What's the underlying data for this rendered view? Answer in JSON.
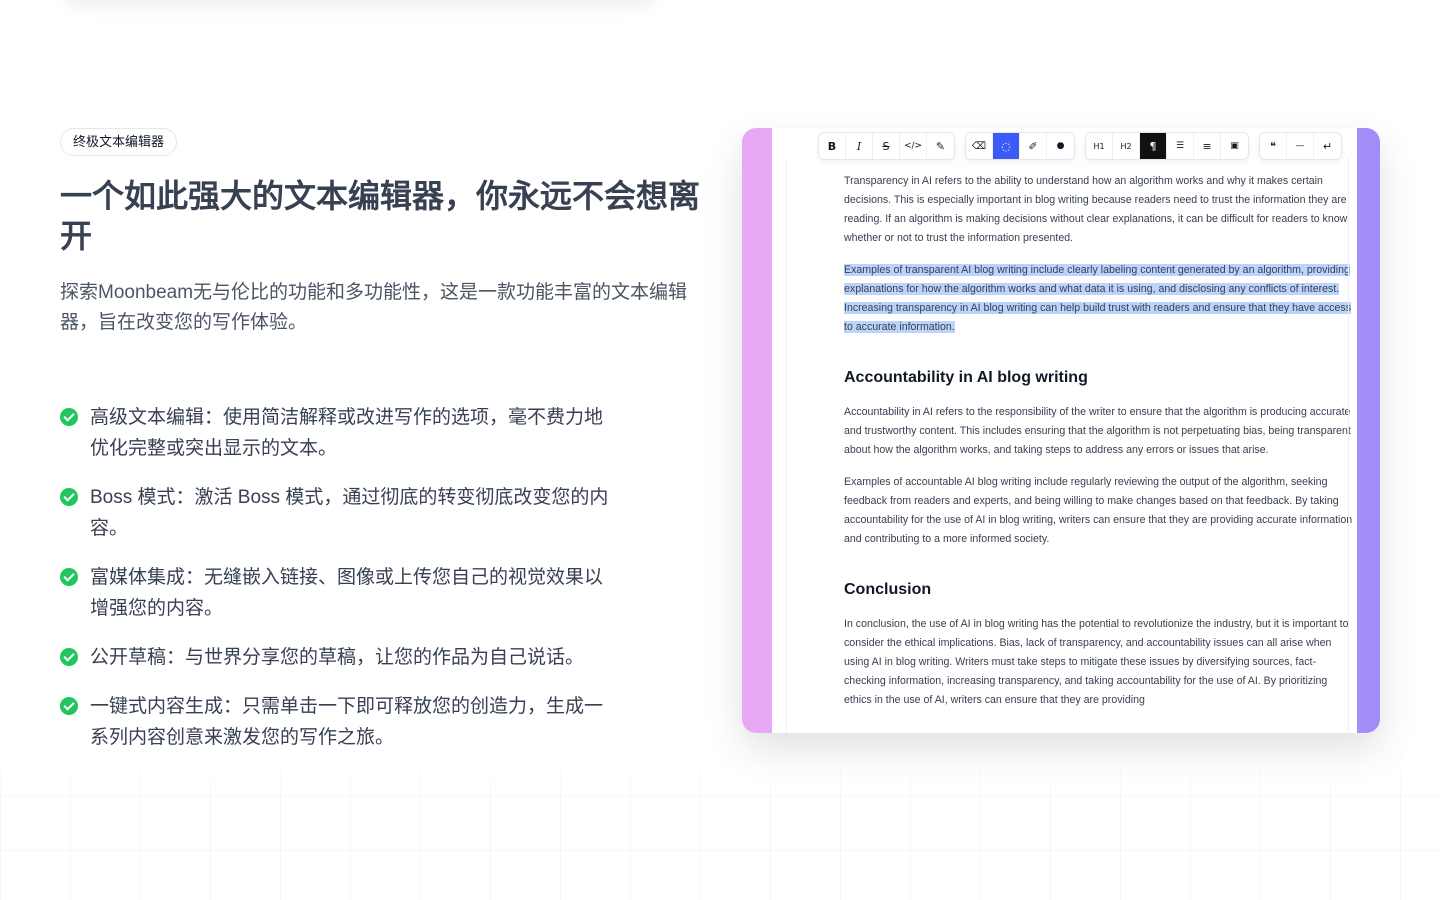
{
  "badge": "终极文本编辑器",
  "headline": "一个如此强大的文本编辑器，你永远不会想离开",
  "subtitle": "探索Moonbeam无与伦比的功能和多功能性，这是一款功能丰富的文本编辑器，旨在改变您的写作体验。",
  "features": [
    "高级文本编辑：使用简洁解释或改进写作的选项，毫不费力地优化完整或突出显示的文本。",
    "Boss 模式：激活 Boss 模式，通过彻底的转变彻底改变您的内容。",
    "富媒体集成：无缝嵌入链接、图像或上传您自己的视觉效果以增强您的内容。",
    "公开草稿：与世界分享您的草稿，让您的作品为自己说话。",
    "一键式内容生成：只需单击一下即可释放您的创造力，生成一系列内容创意来激发您的写作之旅。"
  ],
  "colors": {
    "check": "#22c55e",
    "frame_left": "#e9a8f4",
    "frame_right": "#a38cf7",
    "selection": "#bcd3fb",
    "active_blue": "#3b5bf6"
  },
  "toolbar": {
    "group1": [
      {
        "icon": "bold-icon",
        "glyph": "B"
      },
      {
        "icon": "italic-icon",
        "glyph": "I"
      },
      {
        "icon": "strikethrough-icon",
        "glyph": "S"
      },
      {
        "icon": "code-icon",
        "glyph": "</>"
      },
      {
        "icon": "highlight-pen-icon",
        "glyph": "✎"
      }
    ],
    "group2": [
      {
        "icon": "clear-format-icon",
        "glyph": "⌫"
      },
      {
        "icon": "text-color-icon",
        "glyph": "◌"
      },
      {
        "icon": "pen-icon",
        "glyph": "✐"
      },
      {
        "icon": "ink-drop-icon",
        "glyph": "●"
      }
    ],
    "group3": [
      {
        "icon": "heading1-icon",
        "glyph": "H1"
      },
      {
        "icon": "heading2-icon",
        "glyph": "H2"
      },
      {
        "icon": "paragraph-icon",
        "glyph": "¶"
      },
      {
        "icon": "bullet-list-icon",
        "glyph": "☰"
      },
      {
        "icon": "ordered-list-icon",
        "glyph": "≡"
      },
      {
        "icon": "code-block-icon",
        "glyph": "▣"
      }
    ],
    "group4": [
      {
        "icon": "blockquote-icon",
        "glyph": "❝"
      },
      {
        "icon": "horizontal-rule-icon",
        "glyph": "—"
      },
      {
        "icon": "wrap-text-icon",
        "glyph": "↵"
      }
    ]
  },
  "editor": {
    "p1": "Transparency in AI refers to the ability to understand how an algorithm works and why it makes certain decisions. This is especially important in blog writing because readers need to trust the information they are reading. If an algorithm is making decisions without clear explanations, it can be difficult for readers to know whether or not to trust the information presented.",
    "p2": "Examples of transparent AI blog writing include clearly labeling content generated by an algorithm, providing explanations for how the algorithm works and what data it is using, and disclosing any conflicts of interest. Increasing transparency in AI blog writing can help build trust with readers and ensure that they have access to accurate information.",
    "h_accountability": "Accountability in AI blog writing",
    "p3": "Accountability in AI refers to the responsibility of the writer to ensure that the algorithm is producing accurate and trustworthy content. This includes ensuring that the algorithm is not perpetuating bias, being transparent about how the algorithm works, and taking steps to address any errors or issues that arise.",
    "p4": "Examples of accountable AI blog writing include regularly reviewing the output of the algorithm, seeking feedback from readers and experts, and being willing to make changes based on that feedback. By taking accountability for the use of AI in blog writing, writers can ensure that they are providing accurate information and contributing to a more informed society.",
    "h_conclusion": "Conclusion",
    "p5": "In conclusion, the use of AI in blog writing has the potential to revolutionize the industry, but it is important to consider the ethical implications. Bias, lack of transparency, and accountability issues can all arise when using AI in blog writing. Writers must take steps to mitigate these issues by diversifying sources, fact-checking information, increasing transparency, and taking accountability for the use of AI. By prioritizing ethics in the use of AI, writers can ensure that they are providing"
  }
}
